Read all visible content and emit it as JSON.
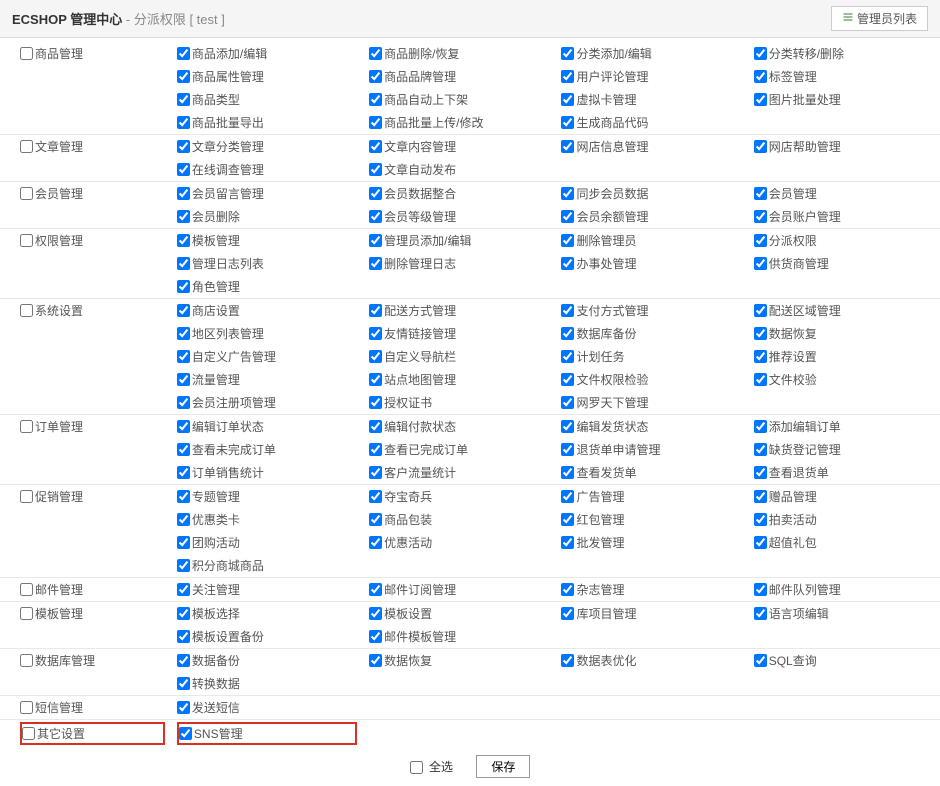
{
  "header": {
    "title": "ECSHOP 管理中心",
    "subtitle": "- 分派权限 [ test ]",
    "button": "管理员列表"
  },
  "footer": {
    "select_all": "全选",
    "save": "保存"
  },
  "groups": [
    {
      "label": "商品管理",
      "rows": [
        [
          "商品添加/编辑",
          "商品删除/恢复",
          "分类添加/编辑",
          "分类转移/删除"
        ],
        [
          "商品属性管理",
          "商品品牌管理",
          "用户评论管理",
          "标签管理"
        ],
        [
          "商品类型",
          "商品自动上下架",
          "虚拟卡管理",
          "图片批量处理"
        ],
        [
          "商品批量导出",
          "商品批量上传/修改",
          "生成商品代码",
          ""
        ]
      ]
    },
    {
      "label": "文章管理",
      "rows": [
        [
          "文章分类管理",
          "文章内容管理",
          "网店信息管理",
          "网店帮助管理"
        ],
        [
          "在线调查管理",
          "文章自动发布",
          "",
          ""
        ]
      ]
    },
    {
      "label": "会员管理",
      "rows": [
        [
          "会员留言管理",
          "会员数据整合",
          "同步会员数据",
          "会员管理"
        ],
        [
          "会员删除",
          "会员等级管理",
          "会员余额管理",
          "会员账户管理"
        ]
      ]
    },
    {
      "label": "权限管理",
      "rows": [
        [
          "模板管理",
          "管理员添加/编辑",
          "删除管理员",
          "分派权限"
        ],
        [
          "管理日志列表",
          "删除管理日志",
          "办事处管理",
          "供货商管理"
        ],
        [
          "角色管理",
          "",
          "",
          ""
        ]
      ]
    },
    {
      "label": "系统设置",
      "rows": [
        [
          "商店设置",
          "配送方式管理",
          "支付方式管理",
          "配送区域管理"
        ],
        [
          "地区列表管理",
          "友情链接管理",
          "数据库备份",
          "数据恢复"
        ],
        [
          "自定义广告管理",
          "自定义导航栏",
          "计划任务",
          "推荐设置"
        ],
        [
          "流量管理",
          "站点地图管理",
          "文件权限检验",
          "文件校验"
        ],
        [
          "会员注册项管理",
          "授权证书",
          "网罗天下管理",
          ""
        ]
      ]
    },
    {
      "label": "订单管理",
      "rows": [
        [
          "编辑订单状态",
          "编辑付款状态",
          "编辑发货状态",
          "添加编辑订单"
        ],
        [
          "查看未完成订单",
          "查看已完成订单",
          "退货单申请管理",
          "缺货登记管理"
        ],
        [
          "订单销售统计",
          "客户流量统计",
          "查看发货单",
          "查看退货单"
        ]
      ]
    },
    {
      "label": "促销管理",
      "rows": [
        [
          "专题管理",
          "夺宝奇兵",
          "广告管理",
          "赠品管理"
        ],
        [
          "优惠类卡",
          "商品包装",
          "红包管理",
          "拍卖活动"
        ],
        [
          "团购活动",
          "优惠活动",
          "批发管理",
          "超值礼包"
        ],
        [
          "积分商城商品",
          "",
          "",
          ""
        ]
      ]
    },
    {
      "label": "邮件管理",
      "rows": [
        [
          "关注管理",
          "邮件订阅管理",
          "杂志管理",
          "邮件队列管理"
        ]
      ]
    },
    {
      "label": "模板管理",
      "rows": [
        [
          "模板选择",
          "模板设置",
          "库项目管理",
          "语言项编辑"
        ],
        [
          "模板设置备份",
          "邮件模板管理",
          "",
          ""
        ]
      ]
    },
    {
      "label": "数据库管理",
      "rows": [
        [
          "数据备份",
          "数据恢复",
          "数据表优化",
          "SQL查询"
        ],
        [
          "转换数据",
          "",
          "",
          ""
        ]
      ]
    },
    {
      "label": "短信管理",
      "rows": [
        [
          "发送短信",
          "",
          "",
          ""
        ]
      ]
    },
    {
      "label": "其它设置",
      "highlight": true,
      "rows": [
        [
          "SNS管理",
          "",
          "",
          ""
        ]
      ]
    }
  ]
}
